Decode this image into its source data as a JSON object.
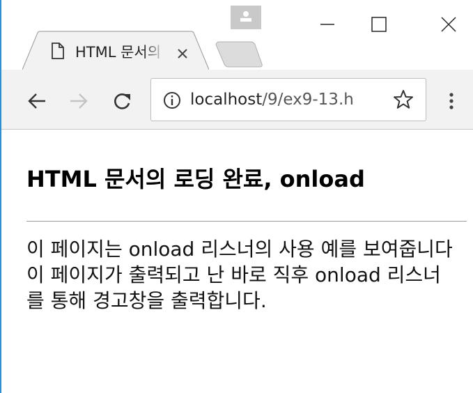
{
  "browser": {
    "tab": {
      "title": "HTML 문서의 로딩 완료, onload",
      "close_symbol": "×"
    },
    "address_bar": {
      "host": "localhost",
      "path": "/9/ex9-13.h"
    },
    "icons": {
      "profile": "profile-icon",
      "minimize": "minimize-icon",
      "maximize": "maximize-icon",
      "close": "close-icon",
      "page": "document-icon",
      "back": "arrow-left-icon",
      "forward": "arrow-right-icon",
      "reload": "reload-icon",
      "info": "info-icon",
      "bookmark": "star-icon",
      "menu": "more-vertical-icon"
    }
  },
  "page": {
    "heading": "HTML 문서의 로딩 완료, onload",
    "paragraph": "이 페이지는 onload 리스너의 사용 예를 보여줍니다 이 페이지가 출력되고 난 바로 직후 onload 리스너를 통해 경고창을 출력합니다."
  }
}
